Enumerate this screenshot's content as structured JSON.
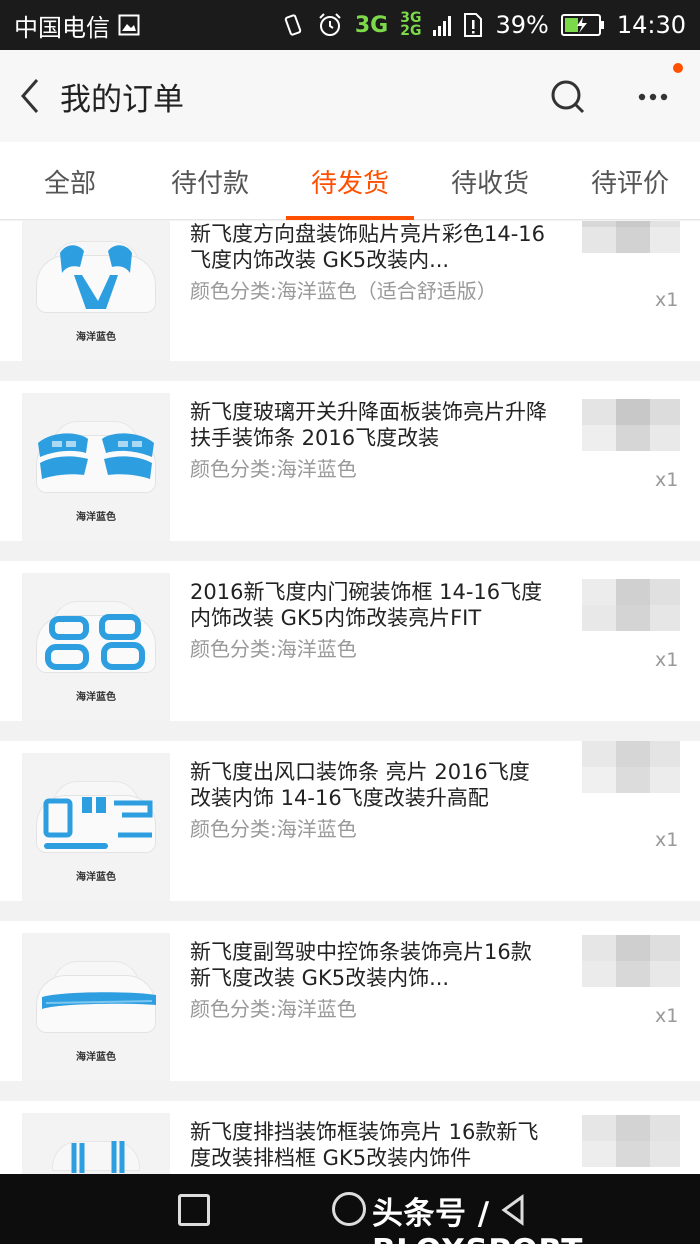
{
  "status_bar": {
    "carrier": "中国电信",
    "network_3g": "3G",
    "network_3g_small": "3G",
    "network_2g_small": "2G",
    "battery": "39%",
    "time": "14:30"
  },
  "nav": {
    "title": "我的订单"
  },
  "tabs": [
    {
      "label": "全部",
      "active": false
    },
    {
      "label": "待付款",
      "active": false
    },
    {
      "label": "待发货",
      "active": true
    },
    {
      "label": "待收货",
      "active": false
    },
    {
      "label": "待评价",
      "active": false
    }
  ],
  "orders": [
    {
      "title": "新飞度方向盘装饰贴片亮片彩色14-16飞度内饰改装 GK5改装内...",
      "sku": "颜色分类:海洋蓝色（适合舒适版）",
      "qty": "x1",
      "thumb_label": "海洋蓝色"
    },
    {
      "title": "新飞度玻璃开关升降面板装饰亮片升降扶手装饰条 2016飞度改装",
      "sku": "颜色分类:海洋蓝色",
      "qty": "x1",
      "thumb_label": "海洋蓝色"
    },
    {
      "title": "2016新飞度内门碗装饰框 14-16飞度内饰改装 GK5内饰改装亮片FIT",
      "sku": "颜色分类:海洋蓝色",
      "qty": "x1",
      "thumb_label": "海洋蓝色"
    },
    {
      "title": "新飞度出风口装饰条 亮片 2016飞度改装内饰 14-16飞度改装升高配",
      "sku": "颜色分类:海洋蓝色",
      "qty": "x1",
      "thumb_label": "海洋蓝色"
    },
    {
      "title": "新飞度副驾驶中控饰条装饰亮片16款新飞度改装 GK5改装内饰...",
      "sku": "颜色分类:海洋蓝色",
      "qty": "x1",
      "thumb_label": "海洋蓝色"
    },
    {
      "title": "新飞度排挡装饰框装饰亮片 16款新飞度改装排档框 GK5改装内饰件",
      "sku": "",
      "qty": "",
      "thumb_label": ""
    }
  ],
  "watermark": "头条号 / BLOXSPORT",
  "colors": {
    "accent": "#ff5000",
    "part_blue": "#2d9ee0",
    "status_bar": "#1b1b1b"
  }
}
